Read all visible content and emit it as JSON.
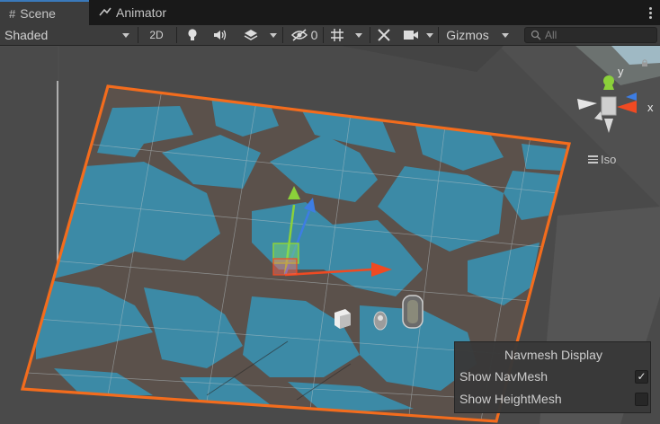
{
  "tabs": [
    {
      "label": "Scene",
      "icon": "grid-icon",
      "active": true
    },
    {
      "label": "Animator",
      "icon": "animator-icon",
      "active": false
    }
  ],
  "toolbar": {
    "draw_mode": "Shaded",
    "mode_2d": "2D",
    "hidden_count": "0",
    "gizmos": "Gizmos",
    "search_placeholder": "All"
  },
  "gizmo": {
    "y_label": "y",
    "x_label": "x",
    "projection": "Iso"
  },
  "navmesh": {
    "title": "Navmesh Display",
    "show_navmesh_label": "Show NavMesh",
    "show_navmesh_checked": true,
    "show_heightmesh_label": "Show HeightMesh",
    "show_heightmesh_checked": false,
    "check_glyph": "✓"
  },
  "colors": {
    "navmesh": "#3c8aa6",
    "ground": "#5b514b",
    "selection_outline": "#f36c1d",
    "axis_x": "#ef4a22",
    "axis_y": "#8bd13a",
    "axis_z": "#3d7de3"
  }
}
